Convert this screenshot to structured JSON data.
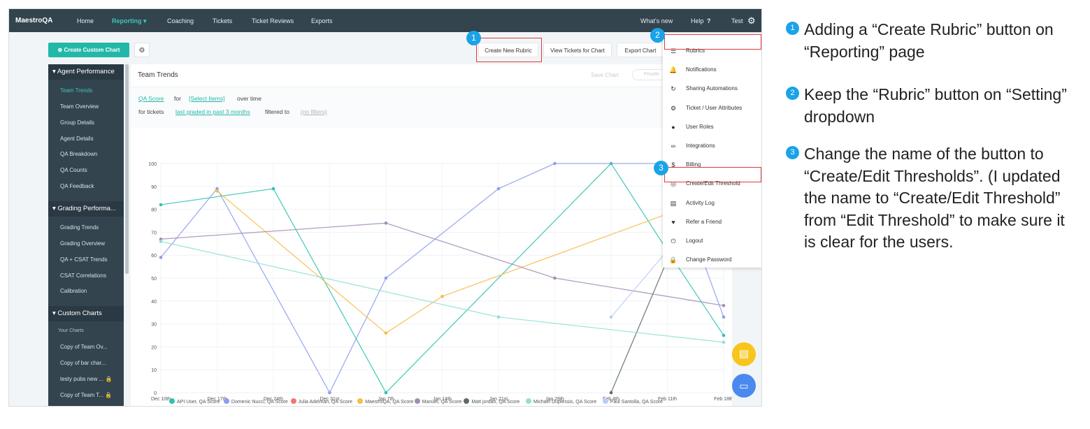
{
  "app": {
    "logo": "MaestroQA",
    "nav": [
      "Home",
      "Reporting ▾",
      "Coaching",
      "Tickets",
      "Ticket Reviews",
      "Exports"
    ],
    "right": {
      "whats_new": "What's new",
      "help": "Help",
      "user": "Test"
    }
  },
  "toolbar": {
    "create_chart": "Create Custom Chart",
    "create_rubric": "Create New Rubric",
    "view_tickets": "View Tickets for Chart",
    "export_chart": "Export Chart"
  },
  "sidebar": {
    "sections": [
      {
        "title": "Agent Performance",
        "items": [
          "Team Trends",
          "Team Overview",
          "Group Details",
          "Agent Details",
          "QA Breakdown",
          "QA Counts",
          "QA Feedback"
        ]
      },
      {
        "title": "Grading Performa...",
        "items": [
          "Grading Trends",
          "Grading Overview",
          "QA + CSAT Trends",
          "CSAT Correlations",
          "Calibration"
        ]
      },
      {
        "title": "Custom Charts",
        "subtitle": "Your Charts",
        "items": [
          "Copy of Team Ov...",
          "Copy of bar char...",
          "testy pubs new ...",
          "Copy of Team T..."
        ]
      }
    ]
  },
  "main": {
    "title": "Team Trends",
    "save_chart": "Save Chart",
    "private": "Private",
    "filter": {
      "metric": "QA Score",
      "for": "for",
      "items": "[Select Items]",
      "over_time": "over time",
      "for_tickets": "for tickets",
      "range": "last graded in past 3 months",
      "filtered_to": "filtered to",
      "filters": "(no filters)"
    }
  },
  "dropdown": {
    "items": [
      {
        "icon": "list-icon",
        "glyph": "☰",
        "label": "Rubrics"
      },
      {
        "icon": "bell-icon",
        "glyph": "🔔",
        "label": "Notifications"
      },
      {
        "icon": "refresh-icon",
        "glyph": "↻",
        "label": "Sharing Automations"
      },
      {
        "icon": "gears-icon",
        "glyph": "⚙",
        "label": "Ticket / User Attributes"
      },
      {
        "icon": "user-icon",
        "glyph": "●",
        "label": "User Roles"
      },
      {
        "icon": "link-icon",
        "glyph": "∞",
        "label": "Integrations"
      },
      {
        "icon": "dollar-icon",
        "glyph": "$",
        "label": "Billing"
      },
      {
        "icon": "threshold-icon",
        "glyph": "◎",
        "label": "Create/Edit Threshold"
      },
      {
        "icon": "log-icon",
        "glyph": "▤",
        "label": "Activity Log"
      },
      {
        "icon": "heart-icon",
        "glyph": "♥",
        "label": "Refer a Friend"
      },
      {
        "icon": "power-icon",
        "glyph": "⏻",
        "label": "Logout"
      },
      {
        "icon": "lock-icon",
        "glyph": "🔒",
        "label": "Change Password"
      }
    ]
  },
  "badges": [
    "1",
    "2",
    "3"
  ],
  "notes": [
    "Adding a “Create Rubric” button on “Reporting” page",
    "Keep the “Rubric” button on “Setting” dropdown",
    "Change the name of the button to “Create/Edit Thresholds”. (I updated the name to “Create/Edit Threshold” from “Edit Threshold” to make sure it is clear for the users."
  ],
  "colors": {
    "accent": "#22b8a8",
    "nav_bg": "#33444f",
    "highlight": "#e3393a",
    "badge": "#1aa3e8"
  },
  "chart_data": {
    "type": "line",
    "title": "",
    "xlabel": "",
    "ylabel": "",
    "categories": [
      "Dec 10th",
      "Dec 17th",
      "Dec 24th",
      "Dec 31st",
      "Jan 7th",
      "Jan 14th",
      "Jan 21st",
      "Jan 28th",
      "Feb 4th",
      "Feb 11th",
      "Feb 18th"
    ],
    "ylim": [
      0,
      100
    ],
    "yticks": [
      0,
      10,
      20,
      30,
      40,
      50,
      60,
      70,
      80,
      90,
      100
    ],
    "grid": true,
    "legend_position": "bottom",
    "series": [
      {
        "name": "API User, QA Score",
        "color": "#2fc3b1",
        "values": [
          82,
          null,
          89,
          null,
          0,
          null,
          null,
          null,
          100,
          62,
          25
        ]
      },
      {
        "name": "Domenic Nucci, QA Score",
        "color": "#8d9df0",
        "values": [
          59,
          89,
          null,
          0,
          50,
          null,
          89,
          100,
          null,
          100,
          33
        ]
      },
      {
        "name": "Julia Adelman, QA Score",
        "color": "#f2776e",
        "values": [
          null,
          null,
          null,
          null,
          null,
          null,
          null,
          null,
          null,
          null,
          null
        ]
      },
      {
        "name": "MaestroQA, QA Score",
        "color": "#f6bd48",
        "values": [
          null,
          88,
          null,
          null,
          26,
          42,
          null,
          null,
          null,
          78,
          null
        ]
      },
      {
        "name": "Manuel, QA Score",
        "color": "#a48db4",
        "values": [
          67,
          null,
          null,
          null,
          74,
          null,
          null,
          50,
          null,
          null,
          38
        ]
      },
      {
        "name": "Matt jordan, QA Score",
        "color": "#5e6a70",
        "values": [
          null,
          null,
          null,
          null,
          null,
          null,
          null,
          null,
          0,
          58,
          null
        ]
      },
      {
        "name": "Michael Duplessis, QA Score",
        "color": "#91e0d6",
        "values": [
          66,
          null,
          null,
          null,
          null,
          null,
          33,
          null,
          null,
          null,
          22
        ]
      },
      {
        "name": "Paul Santolla, QA Score",
        "color": "#b8cdf5",
        "values": [
          null,
          null,
          null,
          null,
          null,
          null,
          null,
          null,
          33,
          62,
          null
        ]
      }
    ]
  }
}
